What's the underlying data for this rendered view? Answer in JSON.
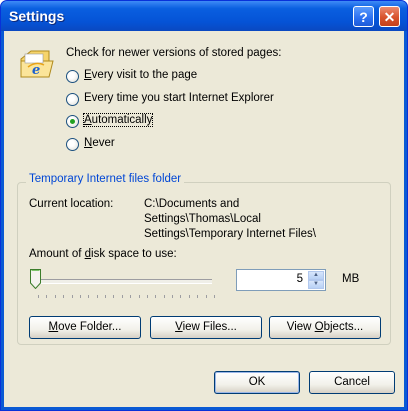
{
  "window": {
    "title": "Settings",
    "help_label": "?",
    "close_label": "✕"
  },
  "check": {
    "heading": "Check for newer versions of stored pages:",
    "options": [
      {
        "label": "Every visit to the page",
        "accel": "E",
        "rest": "very visit to the page",
        "checked": false
      },
      {
        "label": "Every time you start Internet Explorer",
        "accel": "",
        "rest": "Every time you start Internet Explorer",
        "checked": false
      },
      {
        "label": "Automatically",
        "accel": "A",
        "rest": "utomatically",
        "checked": true
      },
      {
        "label": "Never",
        "accel": "N",
        "rest": "ever",
        "checked": false
      }
    ]
  },
  "temp": {
    "group_title": "Temporary Internet files folder",
    "location_label": "Current location:",
    "location_lines": [
      "C:\\Documents and",
      "Settings\\Thomas\\Local",
      "Settings\\Temporary Internet Files\\"
    ],
    "disk_label_pre": "Amount of ",
    "disk_label_accel": "d",
    "disk_label_post": "isk space to use:",
    "disk_value": "5",
    "disk_unit": "MB",
    "slider_fraction": 0.0,
    "buttons": {
      "move": {
        "accel": "M",
        "rest": "ove Folder..."
      },
      "view_files": {
        "accel": "V",
        "rest": "iew Files..."
      },
      "view_objects": {
        "pre": "View ",
        "accel": "O",
        "rest": "bjects..."
      }
    }
  },
  "footer": {
    "ok": "OK",
    "cancel": "Cancel"
  },
  "colors": {
    "title_bar": "#0553d6",
    "group_title": "#0046d5",
    "face": "#ece9d8"
  },
  "icons": {
    "ie_cache": "folder-ie-icon"
  }
}
